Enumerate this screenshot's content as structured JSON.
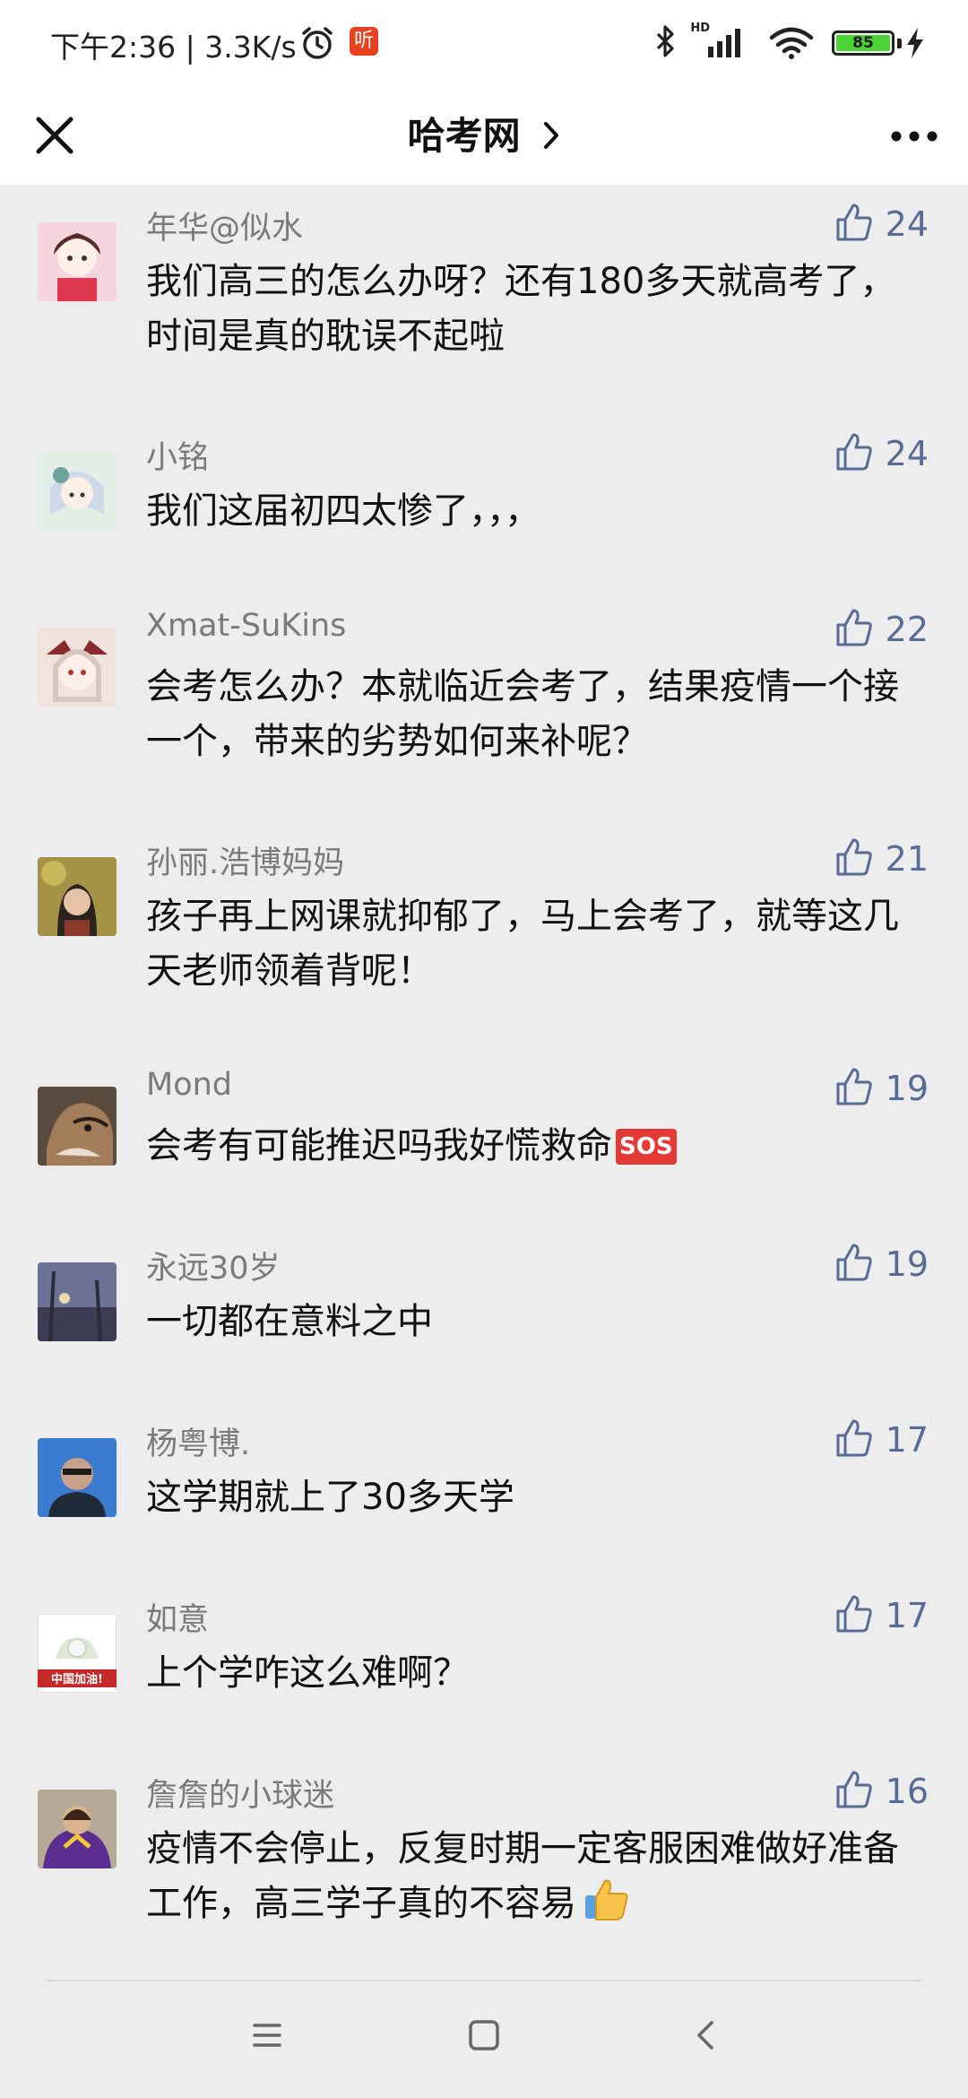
{
  "status_bar": {
    "time_and_speed": "下午2:36 | 3.3K/s",
    "news_badge": "听",
    "hd": "HD",
    "battery": "85",
    "icons": [
      "alarm-icon",
      "bluetooth-icon",
      "signal-icon",
      "wifi-icon",
      "battery-icon",
      "charging-icon"
    ]
  },
  "nav": {
    "title": "哈考网",
    "icons": [
      "close-icon",
      "chevron-right-icon",
      "more-icon"
    ]
  },
  "comments": [
    {
      "author": "年华@似水",
      "likes": "24",
      "text": "我们高三的怎么办呀？还有180多天就高考了，时间是真的耽误不起啦",
      "avatar_color": "#f4c7d4"
    },
    {
      "author": "小铭",
      "likes": "24",
      "text": "我们这届初四太惨了，，，",
      "avatar_color": "#cfe3d4"
    },
    {
      "author": "Xmat-SuKins",
      "likes": "22",
      "text": "会考怎么办？本就临近会考了，结果疫情一个接一个，带来的劣势如何来补呢？",
      "avatar_color": "#e8d2cf"
    },
    {
      "author": "孙丽.浩博妈妈",
      "likes": "21",
      "text": "孩子再上网课就抑郁了，马上会考了，就等这几天老师领着背呢！",
      "avatar_color": "#a89a4c"
    },
    {
      "author": "Mond",
      "likes": "19",
      "text": "会考有可能推迟吗我好慌救命",
      "badge": "SOS",
      "avatar_color": "#7a5a44"
    },
    {
      "author": "永远30岁",
      "likes": "19",
      "text": "一切都在意料之中",
      "avatar_color": "#5a5f7a"
    },
    {
      "author": "杨粤博.",
      "likes": "17",
      "text": "这学期就上了30多天学",
      "avatar_color": "#3b7bd0"
    },
    {
      "author": "如意",
      "likes": "17",
      "text": "上个学咋这么难啊？",
      "avatar_text": "中国加油!",
      "avatar_color": "#c62828"
    },
    {
      "author": "詹詹的小球迷",
      "likes": "16",
      "text": "疫情不会停止，反复时期一定客服困难做好准备工作，高三学子真的不容易",
      "emoji": "thumbs-up-emoji",
      "avatar_color": "#6a3d8f"
    }
  ],
  "system_nav": {
    "icons": [
      "menu-icon",
      "home-icon",
      "back-icon"
    ]
  }
}
